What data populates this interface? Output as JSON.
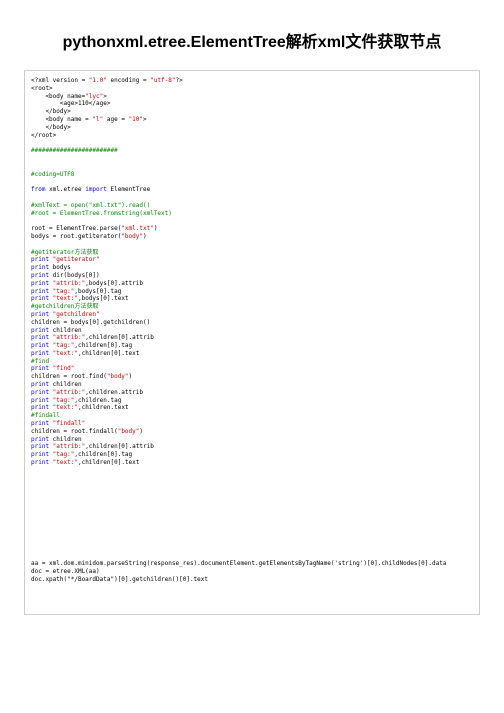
{
  "title": "pythonxml.etree.ElementTree解析xml文件获取节点",
  "h": {
    "p1": "<?xml version = ",
    "v1": "\"1.0\"",
    "p2": " encoding = ",
    "v2": "\"utf-8\"",
    "p3": "?>",
    "r1": "<root>",
    "b1a": "    <body name=",
    "b1v": "\"lyc\"",
    "b1c": ">",
    "age": "        <age>110</age>",
    "bc": "    </body>",
    "b2a": "    <body name = ",
    "b2v": "\"l\"",
    "b2b": " age = ",
    "b2v2": "\"10\"",
    "b2c": ">",
    "bc2": "    </body>",
    "r2": "</root>"
  },
  "sep": "########################",
  "cod": "#coding=UTF8",
  "imp1": "from",
  "imp2": " xml.etree ",
  "imp3": "import",
  "imp4": " ElementTree",
  "c1": "#xmlText = open(\"xml.txt\").read()",
  "c2": "#root = ElementTree.fromstring(xmlText)",
  "r1a": "root = ElementTree.parse(",
  "r1b": "\"xml.txt\"",
  "r1c": ")",
  "r2a": "bodys = root.getiterator(",
  "r2b": "\"body\"",
  "r2c": ")",
  "cm1": "#getiterator方法获取",
  "p": "print",
  "s_gi": " \"getiterator\"",
  "s_bo": " bodys",
  "s_di": " dir(bodys[0])",
  "s_at": " \"attrib:\"",
  "s_at2": ",bodys[0].attrib",
  "s_tg": " \"tag:\"",
  "s_tg2": ",bodys[0].tag",
  "s_tx": " \"text:\"",
  "s_tx2": ",bodys[0].text",
  "cm2": "#getchildren方法获取",
  "s_gc": " \"getchildren\"",
  "ch1": "children = bodys[0].getchildren()",
  "s_ch": " children",
  "s_cat": ",children[0].attrib",
  "s_ctg": ",children[0].tag",
  "s_ctx": ",children[0].text",
  "cm3": "#find",
  "s_fi": " \"find\"",
  "ch2a": "children = root.find(",
  "ch2b": "\"body\"",
  "ch2c": ")",
  "s_cat2": ",children.attrib",
  "s_ctg2": ",children.tag",
  "s_ctx2": ",children.text",
  "cm4": "#findall",
  "s_fa": " \"findall\"",
  "ch3a": "children = root.findall(",
  "ch3b": "\"body\"",
  "ch3c": ")",
  "f1": "aa = xml.dom.minidom.parseString(response_res).documentElement.getElementsByTagName('string')[0].childNodes[0].data",
  "f2": "doc = etree.XML(aa)",
  "f3": "doc.xpath(\"*/BoardData\")[0].getchildren()[0].text"
}
